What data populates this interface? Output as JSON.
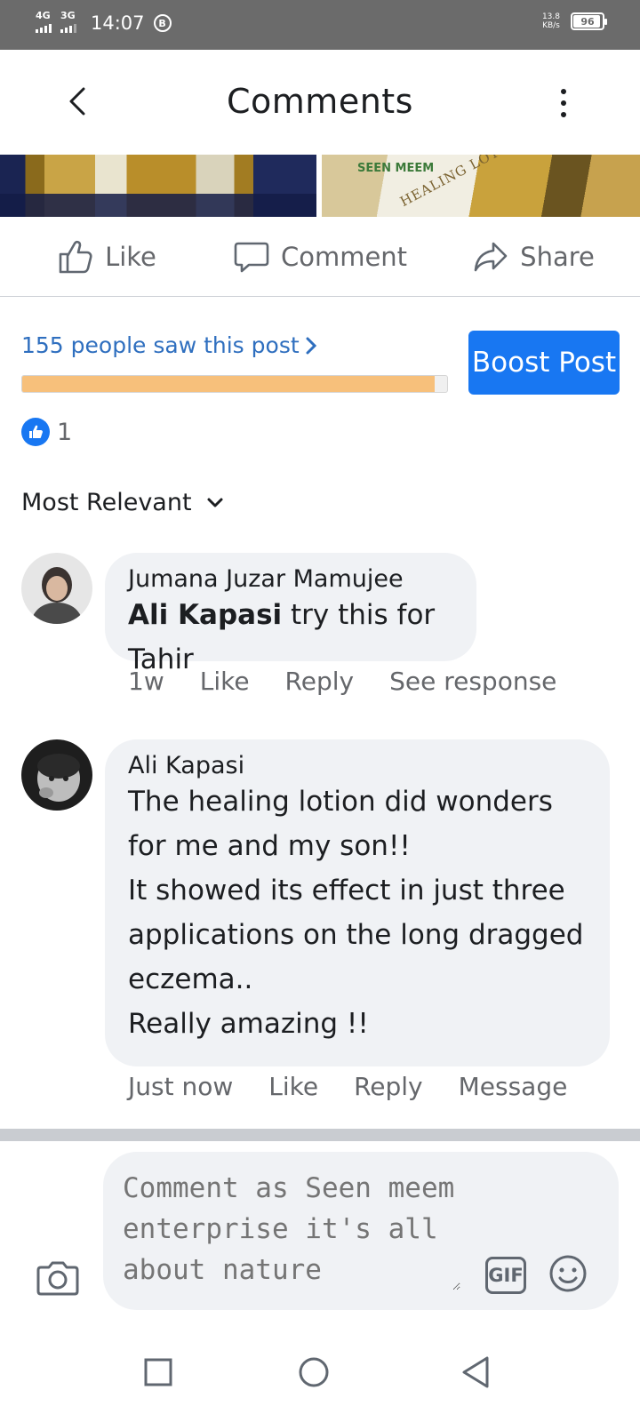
{
  "status_bar": {
    "network_1": "4G",
    "network_2": "3G",
    "time": "14:07",
    "b_badge": "B",
    "speed_value": "13.8",
    "speed_unit": "KB/s",
    "battery": "96"
  },
  "header": {
    "title": "Comments",
    "back_icon": "chevron-left-icon",
    "more_icon": "more-vertical-icon"
  },
  "post": {
    "photo_text": "HEALING LOTION",
    "brand_text": "SEEN MEEM"
  },
  "actions": {
    "like_label": "Like",
    "comment_label": "Comment",
    "share_label": "Share"
  },
  "reach": {
    "text": "155 people saw this post",
    "progress": 0.97,
    "progress_color": "#f7c07b",
    "boost_label": "Boost Post",
    "accent": "#1877f2"
  },
  "reactions": {
    "count": "1"
  },
  "sort": {
    "label": "Most Relevant"
  },
  "comments": [
    {
      "author": "Jumana Juzar Mamujee",
      "mention": "Ali Kapasi",
      "text": " try this for Tahir",
      "time": "1w",
      "like": "Like",
      "reply": "Reply",
      "extra": "See response"
    },
    {
      "author": "Ali Kapasi",
      "text": "The healing lotion did wonders for me and my son!!\nIt showed its effect in just three applications on the long dragged eczema..\nReally amazing !!",
      "time": "Just now",
      "like": "Like",
      "reply": "Reply",
      "extra": "Message"
    }
  ],
  "composer": {
    "placeholder": "Comment as Seen meem enterprise it's all about nature",
    "gif_label": "GIF"
  }
}
